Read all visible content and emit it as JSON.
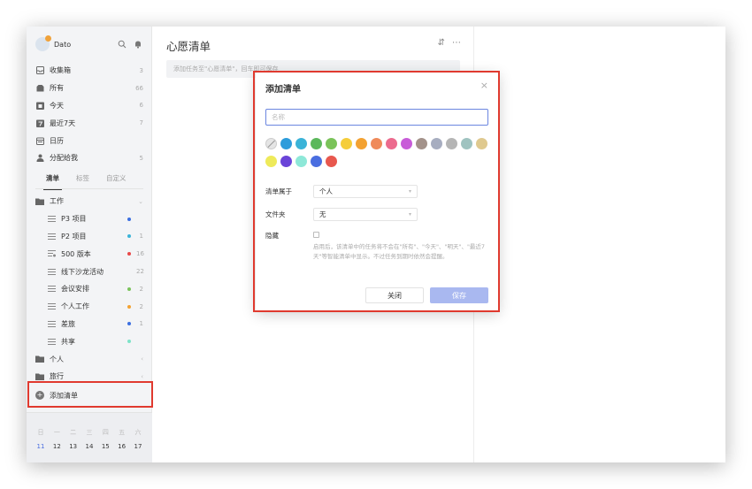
{
  "user": {
    "name": "Dato"
  },
  "nav": [
    {
      "label": "收集箱",
      "count": "3",
      "icon": "inbox-icon"
    },
    {
      "label": "所有",
      "count": "66",
      "icon": "all-icon"
    },
    {
      "label": "今天",
      "count": "6",
      "icon": "today-icon"
    },
    {
      "label": "最近7天",
      "count": "7",
      "icon": "next7days-icon"
    },
    {
      "label": "日历",
      "count": "",
      "icon": "calendar-icon"
    },
    {
      "label": "分配给我",
      "count": "5",
      "icon": "assigned-icon"
    }
  ],
  "tabs": [
    "清单",
    "标签",
    "自定义"
  ],
  "lists": {
    "folder_work": {
      "label": "工作"
    },
    "items": [
      {
        "label": "P3 项目",
        "color": "#3b6fe0",
        "count": ""
      },
      {
        "label": "P2 项目",
        "color": "#3bb3d8",
        "count": "1"
      },
      {
        "label": "500 版本",
        "color": "#e84848",
        "count": "16"
      },
      {
        "label": "线下沙龙活动",
        "color": "",
        "count": "22"
      },
      {
        "label": "会议安排",
        "color": "#7ac35a",
        "count": "2"
      },
      {
        "label": "个人工作",
        "color": "#f3a232",
        "count": "2"
      },
      {
        "label": "差旅",
        "color": "#3b6fe0",
        "count": "1"
      },
      {
        "label": "共享",
        "color": "#7ee3c8",
        "count": ""
      }
    ],
    "folder_personal": {
      "label": "个人"
    },
    "folder_travel": {
      "label": "旅行"
    }
  },
  "add_list": {
    "label": "添加清单"
  },
  "calendar": {
    "weekdays": [
      "日",
      "一",
      "二",
      "三",
      "四",
      "五",
      "六"
    ],
    "days": [
      "11",
      "12",
      "13",
      "14",
      "15",
      "16",
      "17"
    ]
  },
  "main": {
    "title": "心愿清单",
    "add_task_placeholder": "添加任务至\"心愿清单\"，回车即可保存"
  },
  "modal": {
    "title": "添加清单",
    "name_placeholder": "名称",
    "colors_row1": [
      "none",
      "#2d9cdb",
      "#3bb3d8",
      "#5cb85c",
      "#7ac35a",
      "#f5cd3a",
      "#f3a232",
      "#ef8a5a",
      "#ec6b8e",
      "#c85cd8",
      "#a3928a",
      "#a7adc0",
      "#b5b5b5",
      "#9fc3c0",
      "#dfc98f"
    ],
    "colors_row2": [
      "#eeea5a",
      "#6a44d8",
      "#8ee8d8",
      "#4a6ee0",
      "#e8584e"
    ],
    "belongs_label": "清单属于",
    "belongs_value": "个人",
    "folder_label": "文件夹",
    "folder_value": "无",
    "hide_label": "隐藏",
    "hide_hint": "启用后，该清单中的任务将不会在\"所有\"、\"今天\"、\"明天\"、\"最近7天\"等智能清单中显示。不过任务到期时依然会提醒。",
    "cancel": "关闭",
    "save": "保存"
  }
}
